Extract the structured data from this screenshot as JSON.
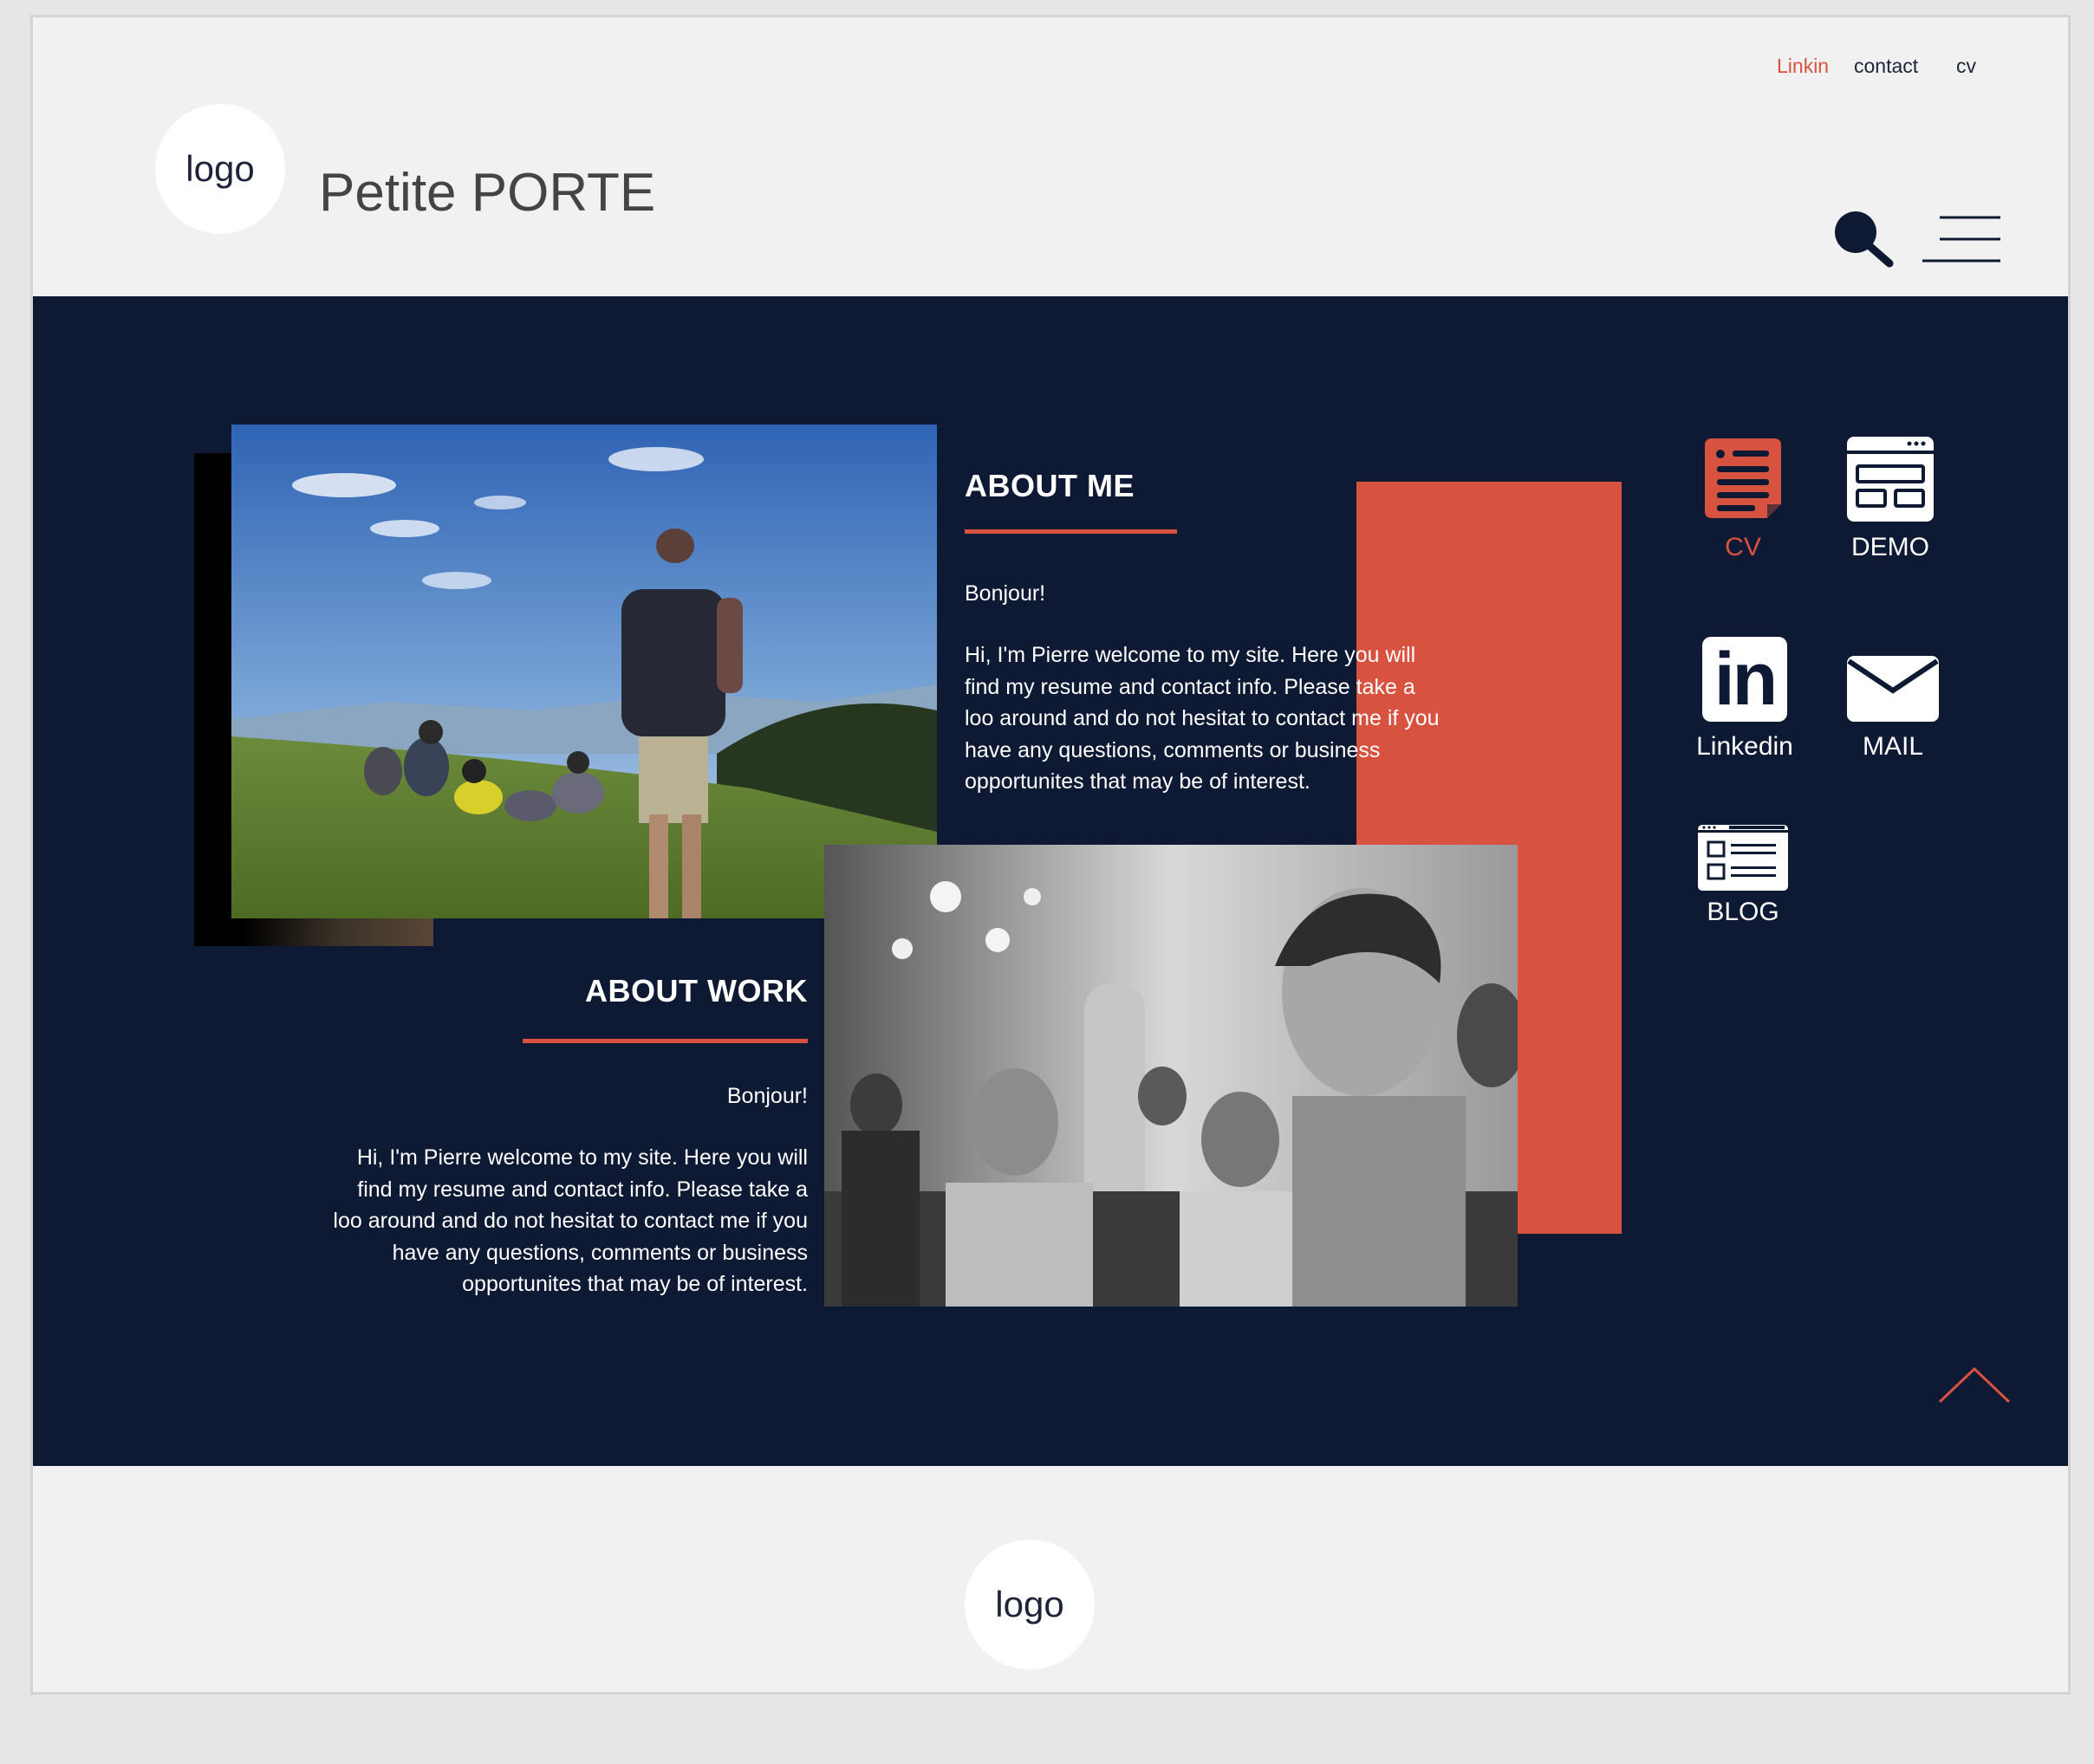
{
  "header": {
    "top_links": [
      "Linkin",
      "contact",
      "cv"
    ],
    "logo_text": "logo",
    "site_title": "Petite PORTE",
    "search_icon": "search-icon",
    "menu_icon": "hamburger-menu-icon"
  },
  "about_me": {
    "title": "ABOUT ME",
    "greeting": "Bonjour!",
    "lines": [
      "Hi, I'm Pierre welcome to my site. Here you will",
      "find my resume and contact info. Please take a",
      "loo around and do not hesitat to contact me if you",
      "have any questions, comments or business",
      "opportunites that may be of interest."
    ]
  },
  "about_work": {
    "title": "ABOUT WORK",
    "greeting": "Bonjour!",
    "lines": [
      "Hi, I'm Pierre welcome to my site. Here you will",
      "find my resume and contact info. Please take a",
      "loo around and do not hesitat to contact me if you",
      "have any questions, comments or business",
      "opportunites that may be of interest."
    ]
  },
  "quick_links": {
    "cv": "CV",
    "demo": "DEMO",
    "linkedin": "Linkedin",
    "mail": "MAIL",
    "blog": "BLOG",
    "linkedin_glyph": "in"
  },
  "footer": {
    "logo_text": "logo"
  },
  "colors": {
    "accent": "#d8533f",
    "navy": "#0e1a34",
    "background": "#f1f1f1"
  }
}
